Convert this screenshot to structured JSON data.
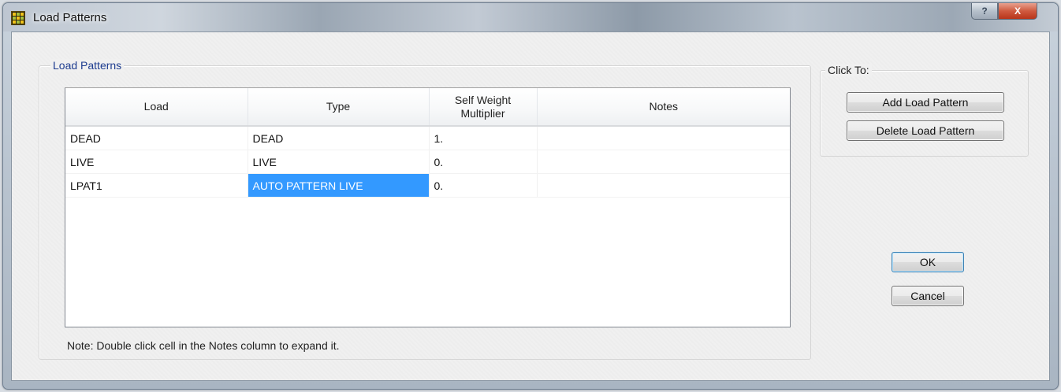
{
  "window": {
    "title": "Load Patterns",
    "help_label": "?",
    "close_label": "X"
  },
  "patterns_group": {
    "label": "Load Patterns",
    "columns": {
      "load": "Load",
      "type": "Type",
      "self_weight_line1": "Self Weight",
      "self_weight_line2": "Multiplier",
      "notes": "Notes"
    },
    "rows": [
      {
        "load": "DEAD",
        "type": "DEAD",
        "multiplier": "1.",
        "notes": "",
        "type_selected": false
      },
      {
        "load": "LIVE",
        "type": "LIVE",
        "multiplier": "0.",
        "notes": "",
        "type_selected": false
      },
      {
        "load": "LPAT1",
        "type": "AUTO PATTERN LIVE",
        "multiplier": "0.",
        "notes": "",
        "type_selected": true
      }
    ],
    "note": "Note:  Double click cell in the Notes column to expand it."
  },
  "click_to_group": {
    "label": "Click To:",
    "add_label": "Add Load Pattern",
    "delete_label": "Delete Load Pattern"
  },
  "actions": {
    "ok_label": "OK",
    "cancel_label": "Cancel"
  },
  "colors": {
    "selection": "#3399ff",
    "group_label": "#1d3c8f"
  }
}
